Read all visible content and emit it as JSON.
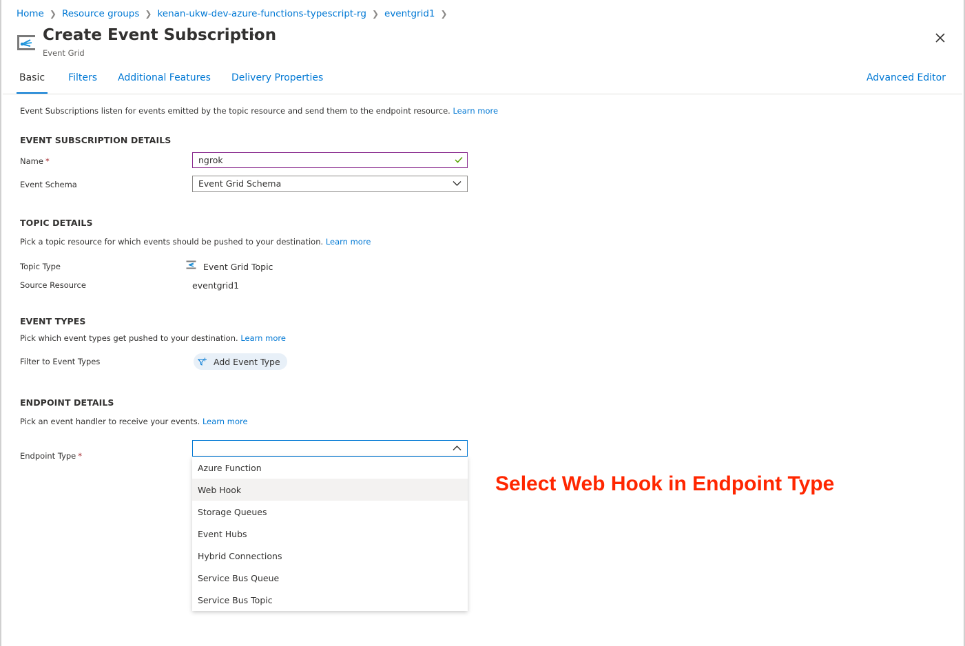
{
  "breadcrumb": {
    "items": [
      "Home",
      "Resource groups",
      "kenan-ukw-dev-azure-functions-typescript-rg",
      "eventgrid1"
    ]
  },
  "header": {
    "title": "Create Event Subscription",
    "more": "···",
    "subtitle": "Event Grid"
  },
  "tabs": {
    "items": [
      "Basic",
      "Filters",
      "Additional Features",
      "Delivery Properties"
    ],
    "active": "Basic",
    "advanced_editor": "Advanced Editor"
  },
  "intro": {
    "text": "Event Subscriptions listen for events emitted by the topic resource and send them to the endpoint resource.",
    "link": "Learn more"
  },
  "subscription_details": {
    "heading": "EVENT SUBSCRIPTION DETAILS",
    "name_label": "Name",
    "name_value": "ngrok",
    "schema_label": "Event Schema",
    "schema_value": "Event Grid Schema"
  },
  "topic_details": {
    "heading": "TOPIC DETAILS",
    "desc": "Pick a topic resource for which events should be pushed to your destination.",
    "link": "Learn more",
    "topic_type_label": "Topic Type",
    "topic_type_value": "Event Grid Topic",
    "source_label": "Source Resource",
    "source_value": "eventgrid1"
  },
  "event_types": {
    "heading": "EVENT TYPES",
    "desc": "Pick which event types get pushed to your destination.",
    "link": "Learn more",
    "filter_label": "Filter to Event Types",
    "add_button": "Add Event Type"
  },
  "endpoint_details": {
    "heading": "ENDPOINT DETAILS",
    "desc": "Pick an event handler to receive your events.",
    "link": "Learn more",
    "endpoint_label": "Endpoint Type",
    "endpoint_value": "",
    "options": [
      "Azure Function",
      "Web Hook",
      "Storage Queues",
      "Event Hubs",
      "Hybrid Connections",
      "Service Bus Queue",
      "Service Bus Topic"
    ],
    "hovered_option": "Web Hook"
  },
  "annotation": {
    "text": "Select Web Hook in Endpoint Type",
    "color": "#ff2600"
  },
  "colors": {
    "accent": "#0078d4",
    "required": "#a4262c",
    "name_border": "#8a2d8f",
    "valid_check": "#57a300"
  }
}
